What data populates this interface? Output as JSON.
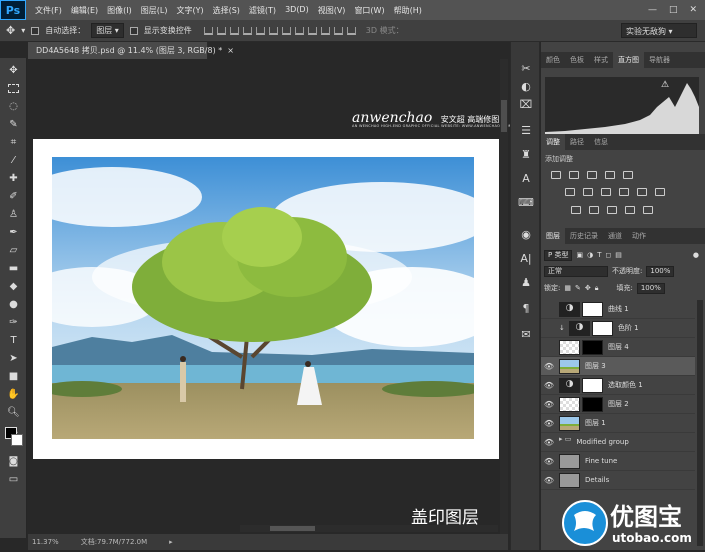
{
  "app": {
    "logo": "Ps"
  },
  "menu": [
    "文件(F)",
    "编辑(E)",
    "图像(I)",
    "图层(L)",
    "文字(Y)",
    "选择(S)",
    "滤镜(T)",
    "3D(D)",
    "视图(V)",
    "窗口(W)",
    "帮助(H)"
  ],
  "options": {
    "auto_select_label": "自动选择：",
    "auto_select_value": "图层",
    "show_transform_label": "显示变换控件",
    "mode_3d": "3D 模式：",
    "workspace": "实验无敌狗"
  },
  "document": {
    "tab_title": "DD4A5648 拷贝.psd @ 11.4% (图层 3, RGB/8) *"
  },
  "watermark": {
    "brand": "anwenchao",
    "brand_cn": "安文超 高端修图",
    "tagline": "AN WENCHAO HIGH-END GRAPHIC OFFICIAL WEBSITE: WWW.ANWENCHAO.COM"
  },
  "caption": "盖印图层",
  "status": {
    "zoom": "11.37%",
    "doc": "文档:79.7M/772.0M"
  },
  "panels": {
    "top_tabs": [
      "颜色",
      "色板",
      "样式",
      "直方图",
      "导航器"
    ],
    "top_active": "直方图",
    "adj_tabs": [
      "调整",
      "路径",
      "信息"
    ],
    "adj_active": "调整",
    "adj_title": "添加调整",
    "layer_tabs": [
      "图层",
      "历史记录",
      "通道",
      "动作"
    ],
    "layer_active": "图层",
    "filter_kind": "P 类型",
    "blend_mode": "正常",
    "opacity_label": "不透明度:",
    "opacity_value": "100%",
    "lock_label": "锁定:",
    "fill_label": "填充:",
    "fill_value": "100%"
  },
  "layers": [
    {
      "name": "曲线 1",
      "thumb": "adjust",
      "eye": false,
      "clip": false
    },
    {
      "name": "色阶 1",
      "thumb": "adjust",
      "eye": false,
      "clip": true
    },
    {
      "name": "图层 4",
      "thumb": "checker",
      "eye": false,
      "clip": false
    },
    {
      "name": "图层 3",
      "thumb": "photo",
      "eye": true,
      "clip": false,
      "selected": true
    },
    {
      "name": "选取颜色 1",
      "thumb": "adjust",
      "eye": true,
      "clip": false
    },
    {
      "name": "图层 2",
      "thumb": "checker",
      "eye": true,
      "clip": false
    },
    {
      "name": "图层 1",
      "thumb": "photo",
      "eye": true,
      "clip": false
    },
    {
      "name": "Modified group",
      "thumb": "folder",
      "eye": true,
      "clip": false
    },
    {
      "name": "Fine tune",
      "thumb": "gray",
      "eye": true,
      "clip": false
    },
    {
      "name": "Details",
      "thumb": "gray",
      "eye": true,
      "clip": false
    }
  ],
  "site_logo": {
    "text": "优图宝",
    "url_text": "utobao.com"
  },
  "colors": {
    "accent": "#31a8ff",
    "panel": "#434343",
    "logo_blue": "#1a8fd8"
  }
}
